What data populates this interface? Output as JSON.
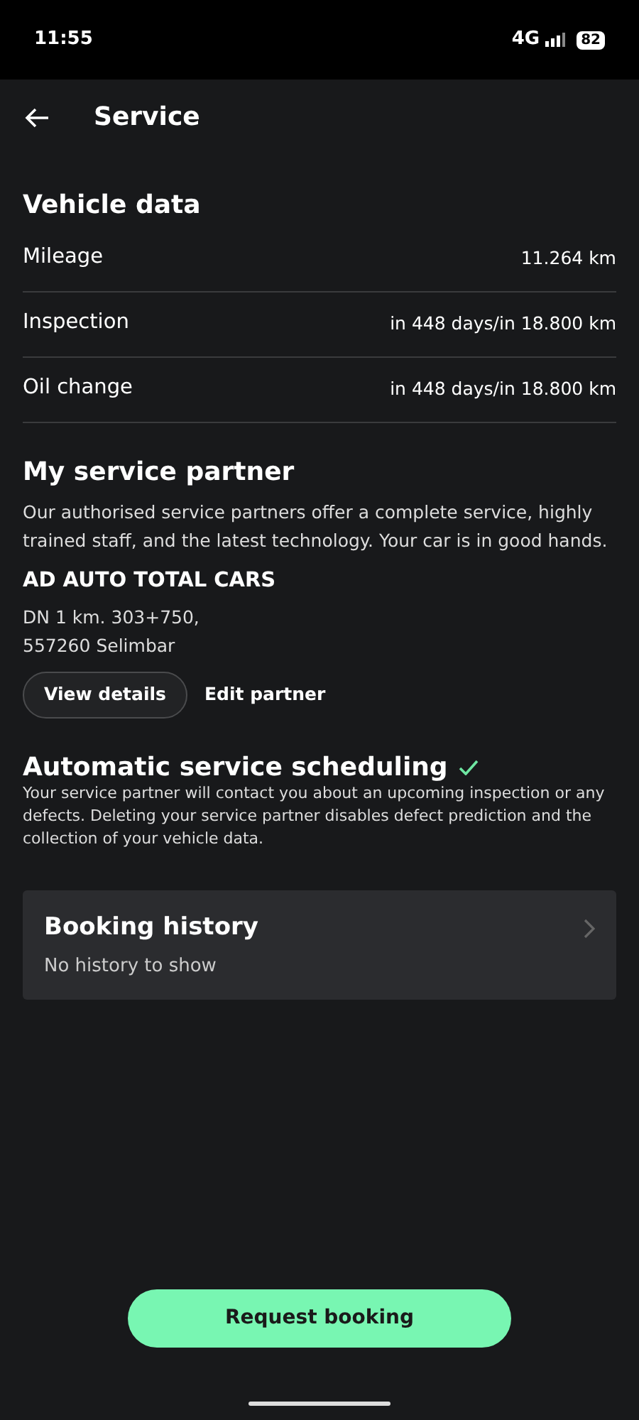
{
  "status_bar": {
    "time": "11:55",
    "network": "4G",
    "battery": "82"
  },
  "header": {
    "title": "Service"
  },
  "vehicle_data": {
    "title": "Vehicle data",
    "rows": [
      {
        "label": "Mileage",
        "value": "11.264 km"
      },
      {
        "label": "Inspection",
        "value": "in 448 days/in 18.800 km"
      },
      {
        "label": "Oil change",
        "value": "in 448 days/in 18.800 km"
      }
    ]
  },
  "service_partner": {
    "title": "My service partner",
    "description": "Our authorised service partners offer a complete service, highly trained staff, and the latest technology. Your car is in good hands.",
    "name": "AD AUTO TOTAL CARS",
    "address": [
      "DN 1 km. 303+750,",
      "557260 Selimbar"
    ],
    "buttons": [
      {
        "label": "View details",
        "kind": "outline"
      },
      {
        "label": "Edit partner",
        "kind": "text"
      }
    ]
  },
  "automatic_scheduling": {
    "title": "Automatic service scheduling",
    "enabled": true,
    "description": "Your service partner will contact you about an upcoming inspection or any defects. Deleting your service partner disables defect prediction and the collection of your vehicle data."
  },
  "booking_history": {
    "title": "Booking history",
    "subtitle": "No history to show"
  },
  "primary_button": {
    "label": "Request booking"
  }
}
